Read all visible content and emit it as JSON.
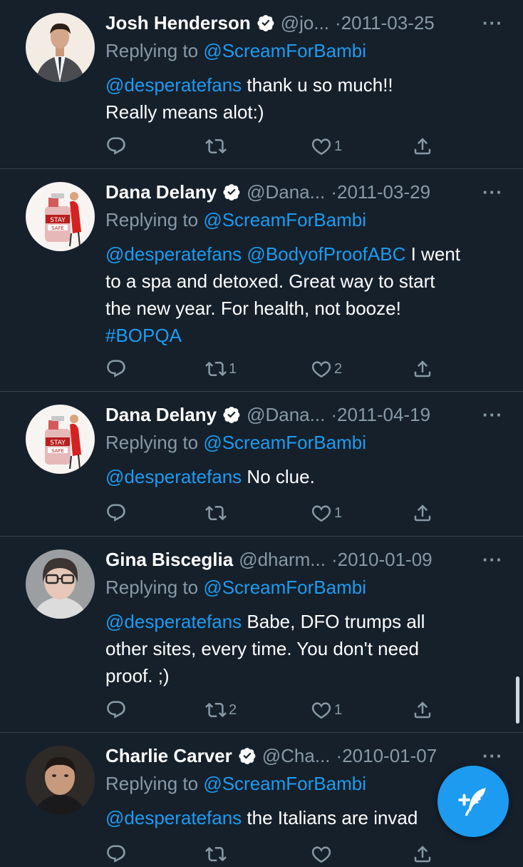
{
  "tweets": [
    {
      "name": "Josh Henderson",
      "verified": true,
      "handle": "@jo...",
      "date": "2011-03-25",
      "replying_prefix": "Replying to ",
      "replying_to": "@ScreamForBambi",
      "mention": "@desperatefans",
      "text_lines": [
        "thank u so much!!",
        "Really means alot:)"
      ],
      "retweets": "",
      "likes": "1",
      "avatar": "man-in-vest"
    },
    {
      "name": "Dana Delany",
      "verified": true,
      "handle": "@Dana...",
      "date": "2011-03-29",
      "replying_prefix": "Replying to ",
      "replying_to": "@ScreamForBambi",
      "mention": "@desperatefans",
      "mention2": "@BodyofProofABC",
      "text_after_mentions": "I went",
      "text_lines": [
        "to a spa and detoxed. Great way to start",
        "the new year. For health, not booze!"
      ],
      "hashtag": "#BOPQA",
      "retweets": "1",
      "likes": "2",
      "avatar": "stay-safe-sanitizer"
    },
    {
      "name": "Dana Delany",
      "verified": true,
      "handle": "@Dana...",
      "date": "2011-04-19",
      "replying_prefix": "Replying to ",
      "replying_to": "@ScreamForBambi",
      "mention": "@desperatefans",
      "text": "No clue.",
      "retweets": "",
      "likes": "1",
      "avatar": "stay-safe-sanitizer"
    },
    {
      "name": "Gina Bisceglia",
      "verified": false,
      "handle": "@dharm...",
      "date": "2010-01-09",
      "replying_prefix": "Replying to ",
      "replying_to": "@ScreamForBambi",
      "mention": "@desperatefans",
      "text_after_mentions": "Babe, DFO trumps all",
      "text_lines": [
        "other sites, every time. You don't need",
        "proof. ;)"
      ],
      "retweets": "2",
      "likes": "1",
      "avatar": "woman-with-glasses"
    },
    {
      "name": "Charlie Carver",
      "verified": true,
      "handle": "@Cha...",
      "date": "2010-01-07",
      "replying_prefix": "Replying to ",
      "replying_to": "@ScreamForBambi",
      "mention": "@desperatefans",
      "text": "the Italians are invad",
      "retweets": "",
      "likes": "",
      "avatar": "man-portrait"
    }
  ],
  "ui": {
    "date_separator": "·",
    "more_label": "···",
    "compose_icon": "compose-tweet-icon",
    "colors": {
      "background": "#15202b",
      "link": "#1d9bf0",
      "muted": "#8899a6",
      "divider": "#38444d"
    }
  }
}
